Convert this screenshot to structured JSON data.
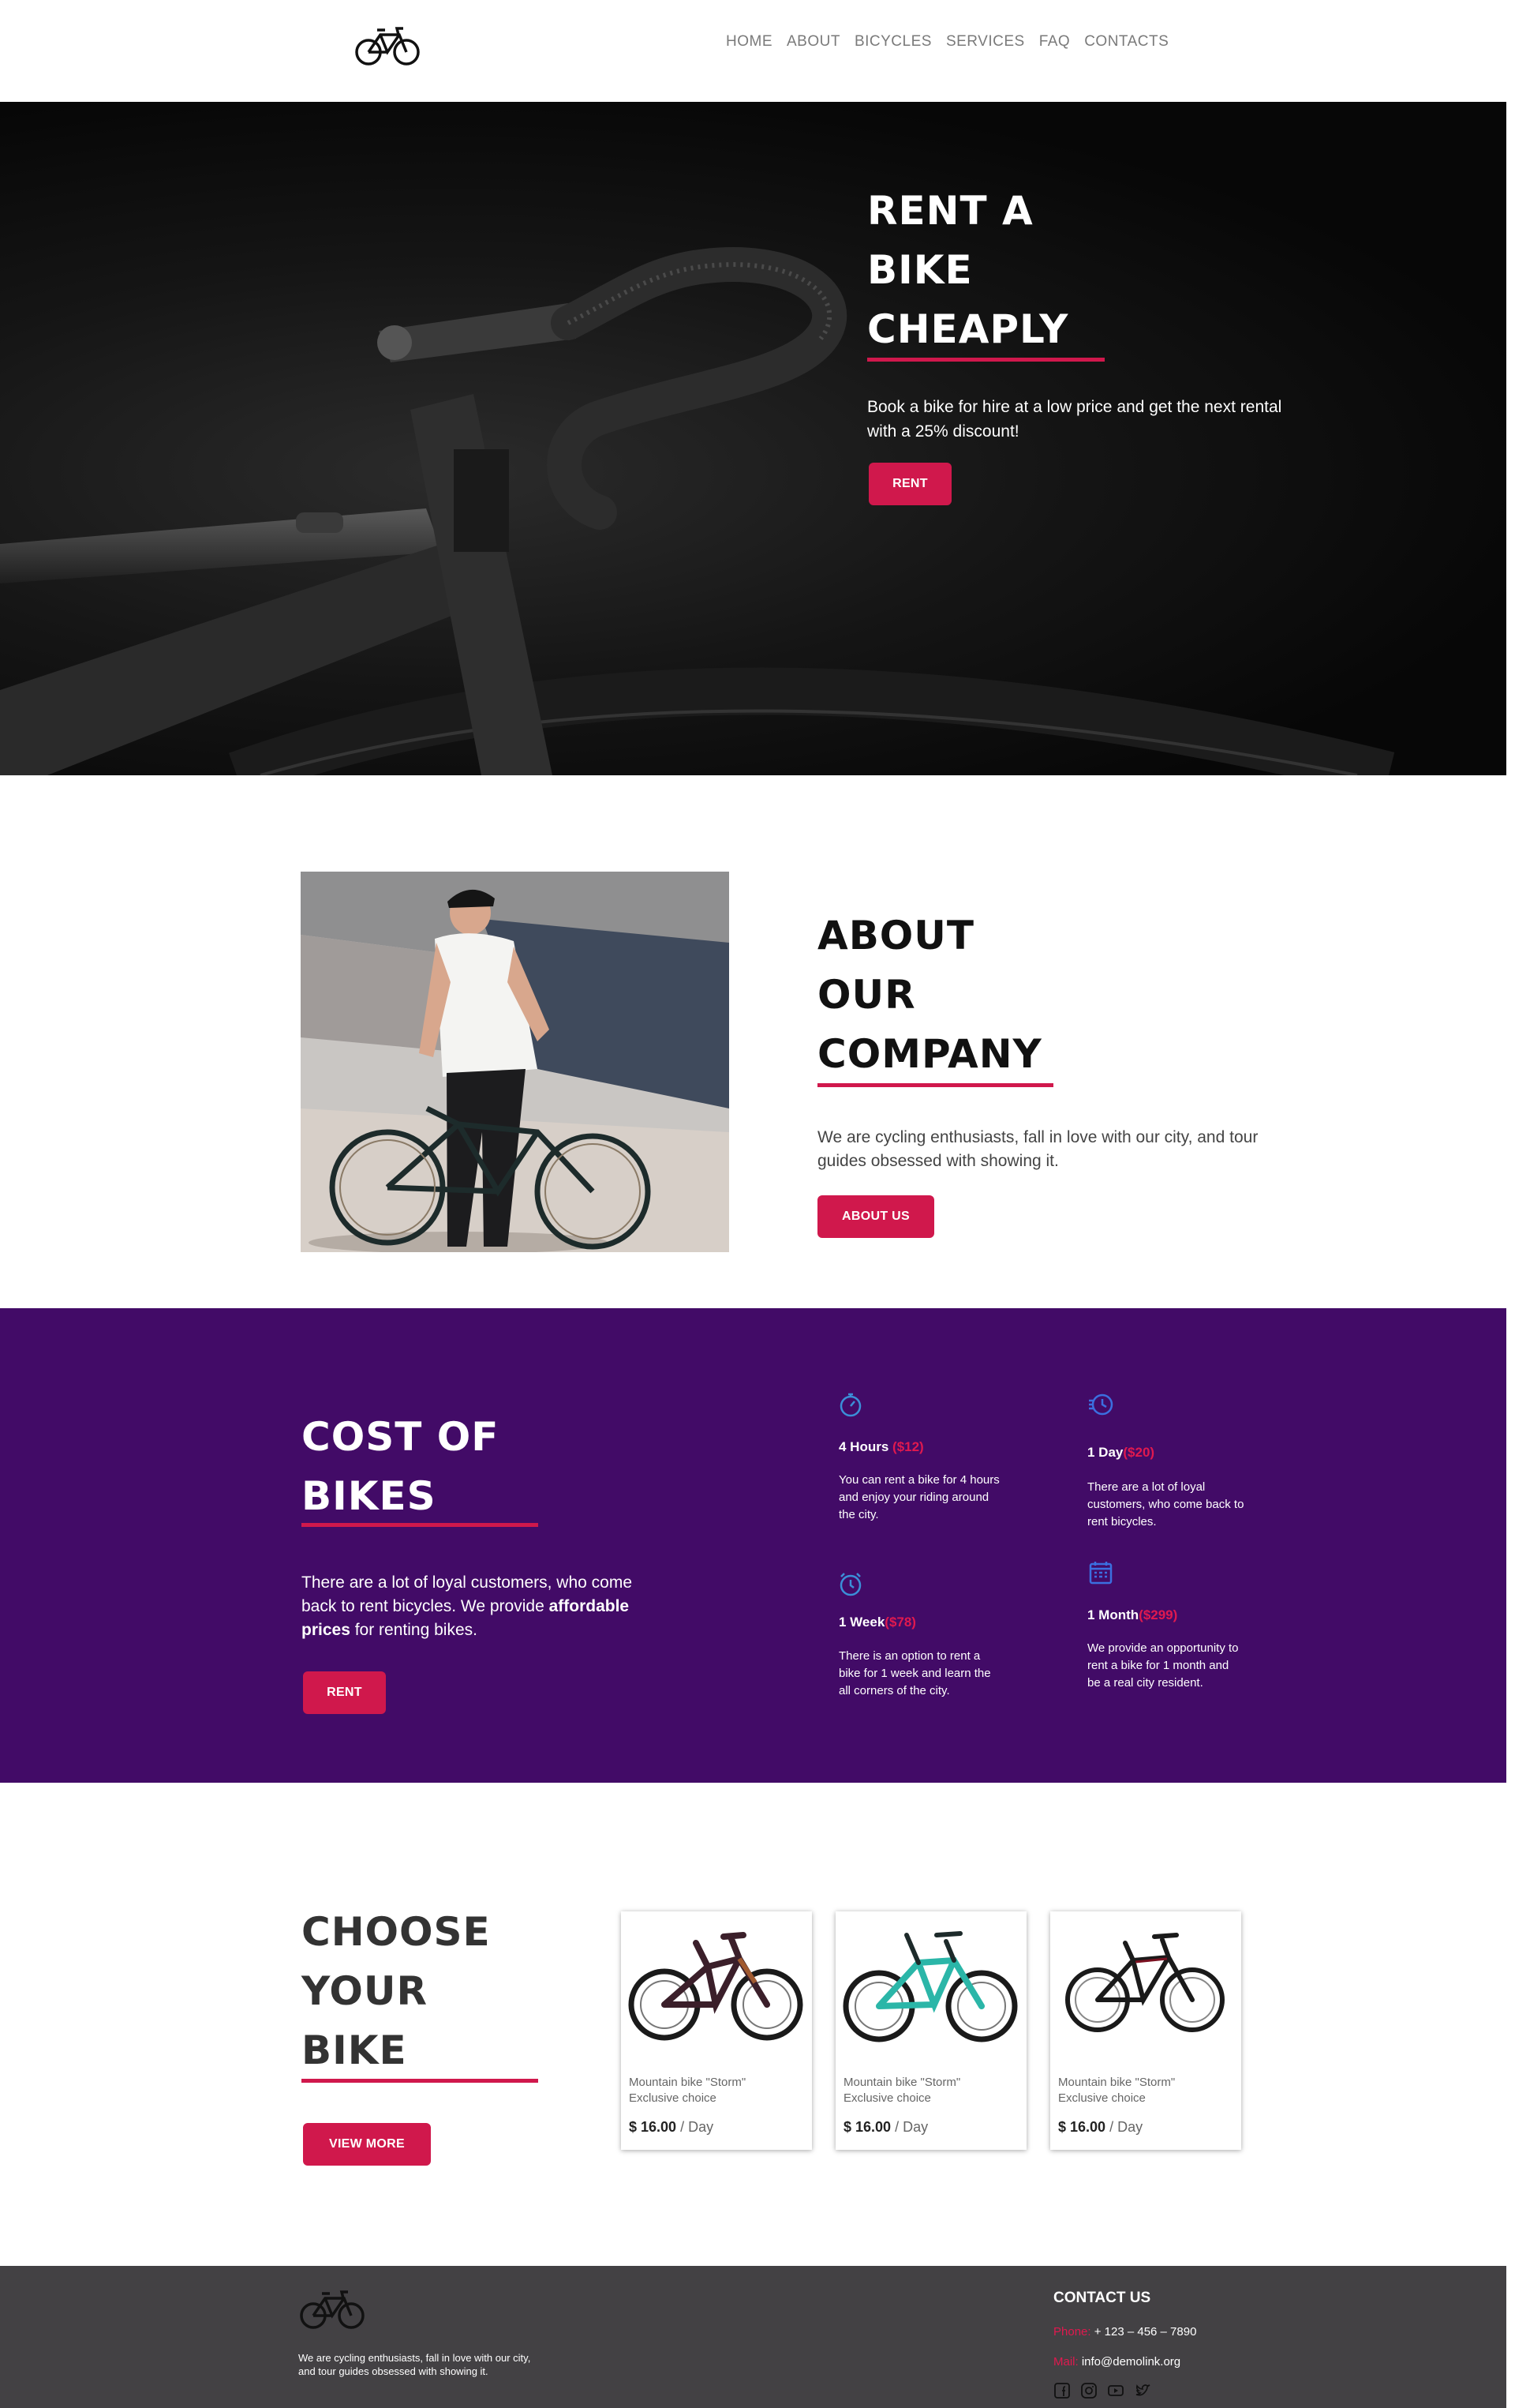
{
  "header": {
    "logo_icon": "bicycle-icon",
    "nav": [
      "HOME",
      "ABOUT",
      "BICYCLES",
      "SERVICES",
      "FAQ",
      "CONTACTS"
    ]
  },
  "hero": {
    "title_lines": [
      "RENT A",
      "BIKE",
      "CHEAPLY"
    ],
    "text": "Book a bike for hire at a low price and get the next rental with a 25% discount!",
    "button": "RENT"
  },
  "about": {
    "title_lines": [
      "ABOUT",
      "OUR",
      "COMPANY"
    ],
    "text": "We are cycling enthusiasts, fall in love with our city, and tour guides obsessed with showing it.",
    "button": "ABOUT US"
  },
  "cost": {
    "title_lines": [
      "COST OF",
      "BIKES"
    ],
    "text_before": "There are a lot of loyal customers, who come back to rent bicycles. We provide ",
    "text_bold": "affordable prices",
    "text_after": " for renting bikes.",
    "button": "RENT",
    "plans": [
      {
        "icon": "stopwatch-icon",
        "name": "4 Hours",
        "price": "($12)",
        "desc": "You can rent a bike for 4 hours and enjoy your riding around the city."
      },
      {
        "icon": "speed-clock-icon",
        "name": "1 Day",
        "price": "($20)",
        "desc": "There are a lot of loyal customers, who come back to rent bicycles."
      },
      {
        "icon": "alarm-clock-icon",
        "name": "1 Week",
        "price": "($78)",
        "desc": "There is an option to rent a bike for 1 week and learn the all corners of the city."
      },
      {
        "icon": "calendar-icon",
        "name": "1 Month",
        "price": "($299)",
        "desc": "We provide an opportunity to rent a bike for 1 month and be a real city resident."
      }
    ]
  },
  "choose": {
    "title_lines": [
      "CHOOSE",
      "YOUR",
      "BIKE"
    ],
    "button": "VIEW MORE",
    "bikes": [
      {
        "name": "Mountain bike \"Storm\"",
        "sub": "Exclusive choice",
        "price": "$ 16.00",
        "unit": " / Day",
        "frame": "#3b1f2a",
        "accent": "#6b3a2a"
      },
      {
        "name": "Mountain bike \"Storm\"",
        "sub": "Exclusive choice",
        "price": "$ 16.00",
        "unit": " / Day",
        "frame": "#1d2a2a",
        "accent": "#2bb6a8"
      },
      {
        "name": "Mountain bike \"Storm\"",
        "sub": "Exclusive choice",
        "price": "$ 16.00",
        "unit": " / Day",
        "frame": "#1a1a1a",
        "accent": "#7a1020"
      }
    ]
  },
  "footer": {
    "text": "We are cycling enthusiasts, fall in love with our city, and tour guides obsessed with showing it.",
    "contact_title": "CONTACT US",
    "phone_label": "Phone:",
    "phone": " + 123 – 456 – 7890",
    "mail_label": "Mail:",
    "mail": " info@demolink.org",
    "socials": [
      "facebook-icon",
      "instagram-icon",
      "youtube-icon",
      "twitter-icon"
    ]
  },
  "colors": {
    "accent": "#d0184c",
    "purple": "#420b67",
    "footer": "#434144"
  }
}
